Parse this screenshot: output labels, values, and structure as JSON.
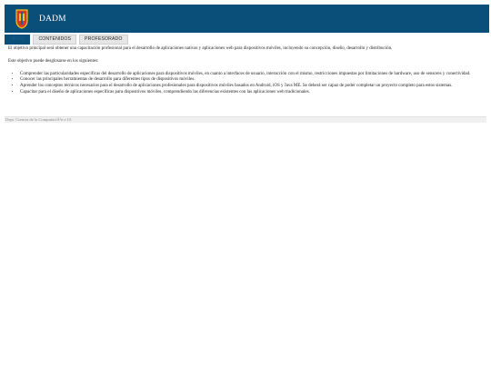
{
  "site": {
    "title": "DADM"
  },
  "nav": {
    "tabs": [
      {
        "label": "INICIO"
      },
      {
        "label": "CONTENIDOS"
      },
      {
        "label": "PROFESORADO"
      }
    ]
  },
  "main": {
    "intro": "El objetivo principal será obtener una capacitación profesional para el desarrollo de aplicaciones nativas y aplicaciones web para dispositivos móviles, incluyendo su concepción, diseño, desarrollo y distribución.",
    "lead": "Este objetivo puede desglosarse en los siguientes:",
    "objectives": [
      "Comprender las particularidades específicas del desarrollo de aplicaciones para dispositivos móviles, en cuanto a interfaces de usuario, interacción con el mismo, restricciones impuestas por limitaciones de hardware, uso de sensores y conectividad.",
      "Conocer las principales herramientas de desarrollo para diferentes tipos de dispositivos móviles.",
      "Aprender los conceptos técnicos necesarios para el desarrollo de aplicaciones profesionales para dispositivos móviles basados en Android, iOS y Java ME. Se deberá ser capaz de poder completar un proyecto completo para estos sistemas.",
      "Capacitar para el diseño de aplicaciones específicas para dispositivos móviles, comprendiendo las diferencias existentes con las aplicaciones web tradicionales."
    ]
  },
  "footer": {
    "text": "Dept. Ciencia de la ComputaciÃ³n e IA"
  },
  "colors": {
    "header_bg": "#0a4e7a",
    "logo_red": "#d23b2a",
    "logo_yellow": "#f0c419"
  },
  "icons": {
    "logo": "shield-logo-icon"
  }
}
